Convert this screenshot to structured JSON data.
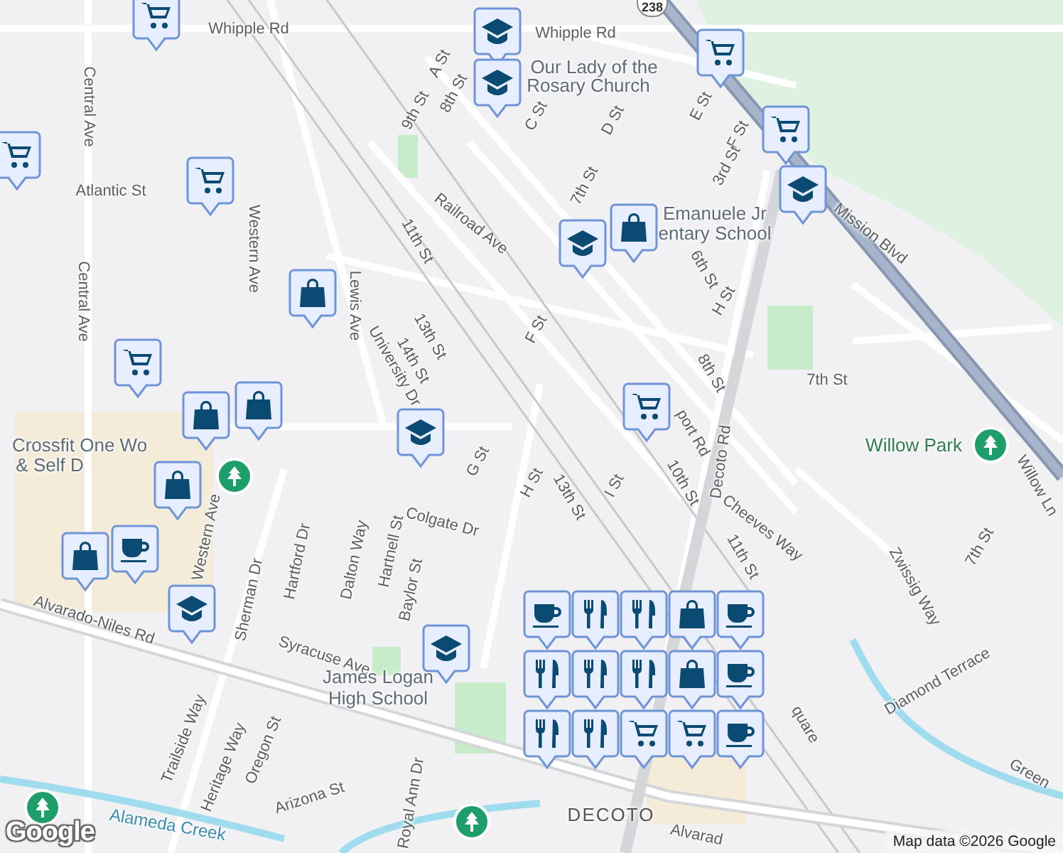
{
  "map": {
    "route_shield": "238",
    "labels": [
      {
        "text": "Whipple Rd",
        "kind": "street"
      },
      {
        "text": "Whipple Rd",
        "kind": "street"
      },
      {
        "text": "A St",
        "kind": "street"
      },
      {
        "text": "8th St",
        "kind": "street"
      },
      {
        "text": "9th St",
        "kind": "street"
      },
      {
        "text": "C St",
        "kind": "street"
      },
      {
        "text": "D St",
        "kind": "street"
      },
      {
        "text": "E St",
        "kind": "street"
      },
      {
        "text": "Our Lady of the",
        "kind": "place"
      },
      {
        "text": "Rosary Church",
        "kind": "place"
      },
      {
        "text": "Central Ave",
        "kind": "street"
      },
      {
        "text": "Atlantic St",
        "kind": "street"
      },
      {
        "text": "Western Ave",
        "kind": "street"
      },
      {
        "text": "Central Ave",
        "kind": "street"
      },
      {
        "text": "Railroad Ave",
        "kind": "street"
      },
      {
        "text": "11th St",
        "kind": "street"
      },
      {
        "text": "7th St",
        "kind": "street"
      },
      {
        "text": "Emanuele Jr",
        "kind": "place"
      },
      {
        "text": "entary School",
        "kind": "place"
      },
      {
        "text": "F St",
        "kind": "street"
      },
      {
        "text": "3rd St",
        "kind": "street"
      },
      {
        "text": "6th St",
        "kind": "street"
      },
      {
        "text": "H St",
        "kind": "street"
      },
      {
        "text": "Mission Blvd",
        "kind": "street"
      },
      {
        "text": "13th St",
        "kind": "street"
      },
      {
        "text": "14th St",
        "kind": "street"
      },
      {
        "text": "University Dr",
        "kind": "street"
      },
      {
        "text": "F St",
        "kind": "street"
      },
      {
        "text": "Lewis Ave",
        "kind": "street"
      },
      {
        "text": "8th St",
        "kind": "street"
      },
      {
        "text": "7th St",
        "kind": "street"
      },
      {
        "text": "Decoto Rd",
        "kind": "street"
      },
      {
        "text": "port Rd",
        "kind": "street"
      },
      {
        "text": "Willow Park",
        "kind": "park"
      },
      {
        "text": "Willow Ln",
        "kind": "street"
      },
      {
        "text": "G St",
        "kind": "street"
      },
      {
        "text": "H St",
        "kind": "street"
      },
      {
        "text": "13th St",
        "kind": "street"
      },
      {
        "text": "I St",
        "kind": "street"
      },
      {
        "text": "10th St",
        "kind": "street"
      },
      {
        "text": "Cheeves Way",
        "kind": "street"
      },
      {
        "text": "Colgate Dr",
        "kind": "street"
      },
      {
        "text": "Crossfit One Wo",
        "kind": "place"
      },
      {
        "text": "& Self D",
        "kind": "place"
      },
      {
        "text": "Western Ave",
        "kind": "street"
      },
      {
        "text": "Hartford Dr",
        "kind": "street"
      },
      {
        "text": "Dalton Way",
        "kind": "street"
      },
      {
        "text": "Hartnell St",
        "kind": "street"
      },
      {
        "text": "Baylor St",
        "kind": "street"
      },
      {
        "text": "Sherman Dr",
        "kind": "street"
      },
      {
        "text": "7th St",
        "kind": "street"
      },
      {
        "text": "11th St",
        "kind": "street"
      },
      {
        "text": "Zwissig Way",
        "kind": "street"
      },
      {
        "text": "Syracuse Ave",
        "kind": "street"
      },
      {
        "text": "James Logan",
        "kind": "place"
      },
      {
        "text": "High School",
        "kind": "place"
      },
      {
        "text": "Alvarado-Niles Rd",
        "kind": "street"
      },
      {
        "text": "Diamond Terrace",
        "kind": "street"
      },
      {
        "text": "Trailside Way",
        "kind": "street"
      },
      {
        "text": "Heritage Way",
        "kind": "street"
      },
      {
        "text": "Oregon St",
        "kind": "street"
      },
      {
        "text": "Arizona St",
        "kind": "street"
      },
      {
        "text": "Royal Ann Dr",
        "kind": "street"
      },
      {
        "text": "Alameda Creek",
        "kind": "water"
      },
      {
        "text": "DECOTO",
        "kind": "area"
      },
      {
        "text": "Alvarad",
        "kind": "street"
      },
      {
        "text": "Green",
        "kind": "street"
      },
      {
        "text": "quare",
        "kind": "street"
      }
    ],
    "markers": [
      {
        "kind": "cart"
      },
      {
        "kind": "school"
      },
      {
        "kind": "school"
      },
      {
        "kind": "cart"
      },
      {
        "kind": "cart"
      },
      {
        "kind": "school"
      },
      {
        "kind": "cart"
      },
      {
        "kind": "cart"
      },
      {
        "kind": "school"
      },
      {
        "kind": "bag"
      },
      {
        "kind": "bag"
      },
      {
        "kind": "cart"
      },
      {
        "kind": "bag"
      },
      {
        "kind": "bag"
      },
      {
        "kind": "school"
      },
      {
        "kind": "cart"
      },
      {
        "kind": "bag"
      },
      {
        "kind": "coffee"
      },
      {
        "kind": "bag"
      },
      {
        "kind": "school"
      },
      {
        "kind": "school"
      },
      {
        "kind": "bag"
      },
      {
        "kind": "food"
      },
      {
        "kind": "food"
      },
      {
        "kind": "food"
      },
      {
        "kind": "food"
      },
      {
        "kind": "food"
      },
      {
        "kind": "coffee"
      },
      {
        "kind": "bag"
      },
      {
        "kind": "cart"
      },
      {
        "kind": "cart"
      },
      {
        "kind": "food"
      },
      {
        "kind": "food"
      },
      {
        "kind": "coffee"
      },
      {
        "kind": "coffee"
      },
      {
        "kind": "coffee"
      },
      {
        "kind": "park"
      },
      {
        "kind": "park"
      },
      {
        "kind": "park"
      },
      {
        "kind": "park"
      }
    ],
    "logo": "Google",
    "attribution": "Map data ©2026 Google"
  }
}
